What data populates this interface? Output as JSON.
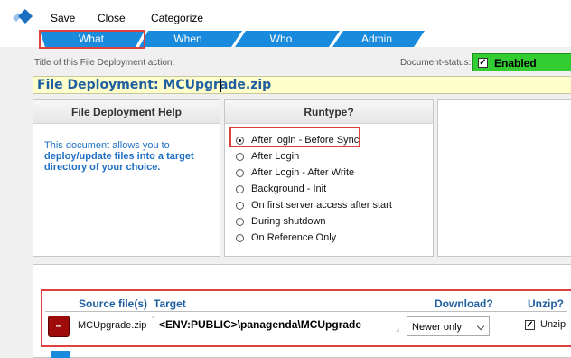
{
  "toolbar": {
    "save": "Save",
    "close": "Close",
    "categorize": "Categorize"
  },
  "tabs": [
    {
      "label": "What",
      "active": true
    },
    {
      "label": "When",
      "active": false
    },
    {
      "label": "Who",
      "active": false
    },
    {
      "label": "Admin",
      "active": false
    }
  ],
  "form": {
    "title_caption": "Title of this File Deployment action:",
    "title_value": "File Deployment: MCUpgrade.zip",
    "status_caption": "Document-status:",
    "status_value": "Enabled",
    "status_checked": true
  },
  "help_panel": {
    "heading": "File Deployment Help",
    "line1": "This document allows you to",
    "line2": "deploy/update files into a target",
    "line3": "directory of your choice."
  },
  "runtype_panel": {
    "heading": "Runtype?",
    "options": [
      "After login - Before Sync",
      "After Login",
      "After Login - After Write",
      "Background - Init",
      "On first server access after start",
      "During shutdown",
      "On Reference Only"
    ],
    "selected": "After login - Before Sync"
  },
  "files_table": {
    "headers": {
      "source": "Source file(s)",
      "target": "Target",
      "download": "Download?",
      "unzip": "Unzip?"
    },
    "rows": [
      {
        "delete_label": "–",
        "source": "MCUpgrade.zip",
        "target": "<ENV:PUBLIC>\\panagenda\\MCUpgrade",
        "download": "Newer only",
        "unzip_label": "Unzip",
        "unzip_checked": true
      }
    ]
  },
  "colors": {
    "tab_blue": "#1a8adc",
    "link_blue": "#1f5fa0",
    "enabled_green": "#33cc33",
    "highlight_red": "#e04040",
    "title_bg": "#ffffcc"
  }
}
